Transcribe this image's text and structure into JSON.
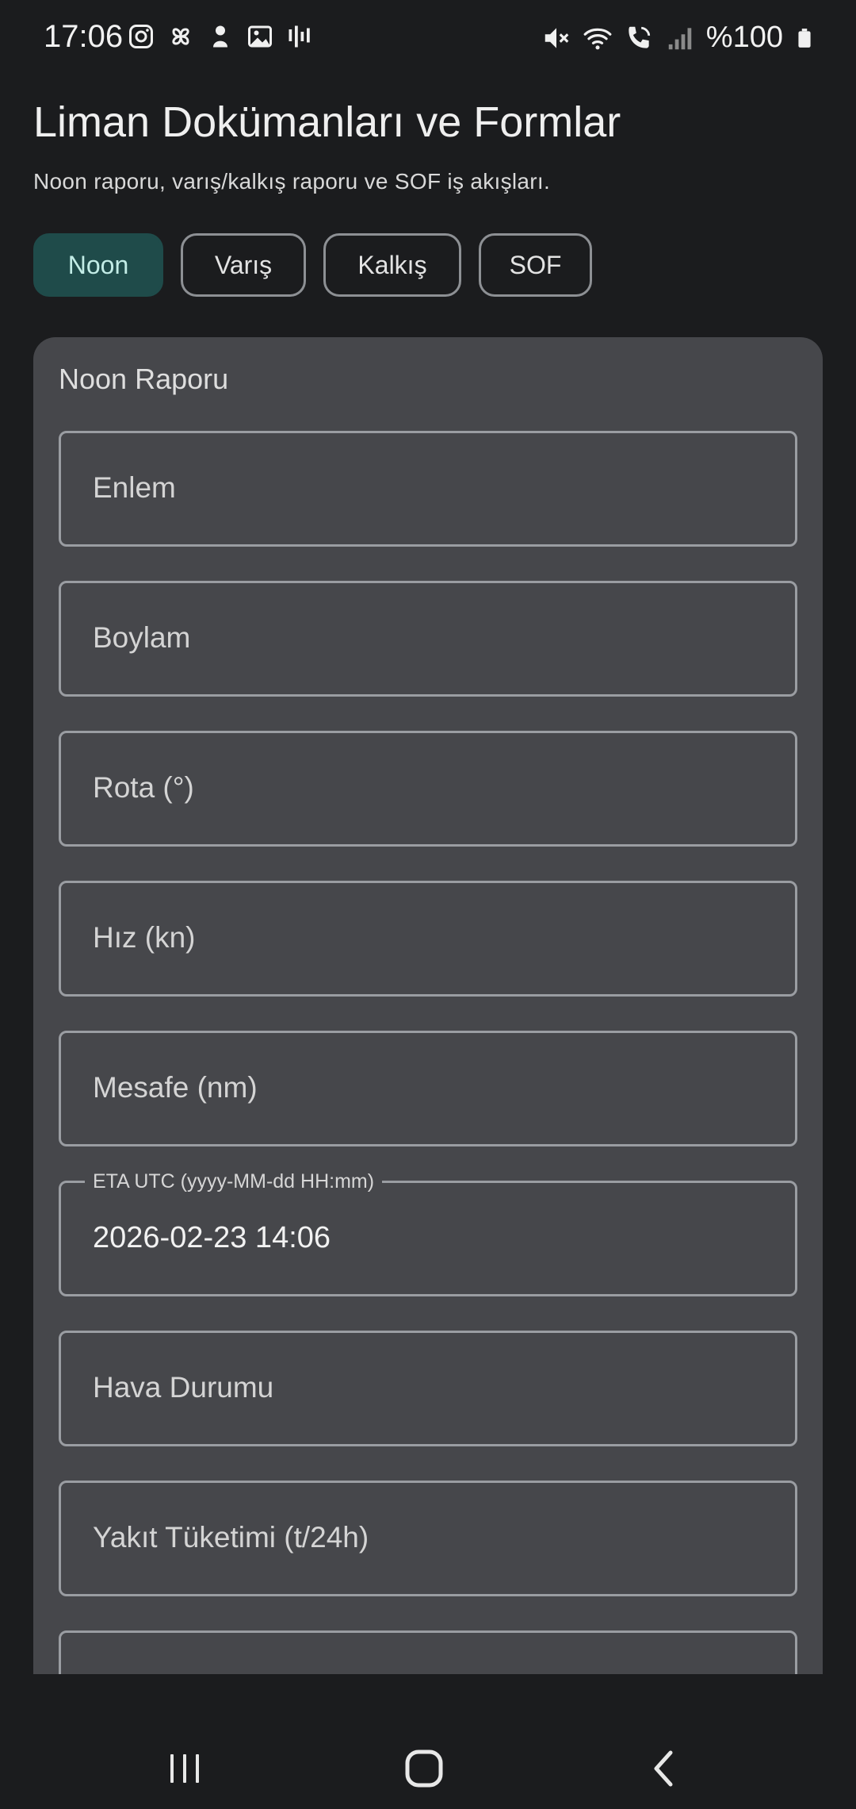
{
  "status": {
    "time": "17:06",
    "battery": "%100",
    "left_icons": [
      "instagram-icon",
      "pinwheel-icon",
      "character-icon",
      "gallery-icon",
      "audio-bars-icon"
    ],
    "right_icons": [
      "mute-icon",
      "wifi-icon",
      "wifi-call-icon",
      "signal-icon",
      "battery-icon"
    ]
  },
  "header": {
    "title": "Liman Dokümanları ve Formlar",
    "subtitle": "Noon raporu, varış/kalkış raporu ve SOF iş akışları."
  },
  "tabs": [
    {
      "label": "Noon",
      "active": true
    },
    {
      "label": "Varış",
      "active": false
    },
    {
      "label": "Kalkış",
      "active": false
    },
    {
      "label": "SOF",
      "active": false
    }
  ],
  "form": {
    "title": "Noon Raporu",
    "fields": [
      {
        "placeholder": "Enlem"
      },
      {
        "placeholder": "Boylam"
      },
      {
        "placeholder": "Rota (°)"
      },
      {
        "placeholder": "Hız (kn)"
      },
      {
        "placeholder": "Mesafe (nm)"
      },
      {
        "label": "ETA UTC (yyyy-MM-dd HH:mm)",
        "value": "2026-02-23 14:06"
      },
      {
        "placeholder": "Hava Durumu"
      },
      {
        "placeholder": "Yakıt Tüketimi (t/24h)"
      },
      {
        "placeholder": ""
      }
    ]
  },
  "colors": {
    "background": "#1b1c1e",
    "card": "#46474b",
    "tab_active_bg": "#1f4b4a",
    "tab_active_text": "#c2ece6",
    "field_border": "#9a9da2"
  },
  "navbar": {
    "buttons": [
      "recents-icon",
      "home-icon",
      "back-icon"
    ]
  }
}
